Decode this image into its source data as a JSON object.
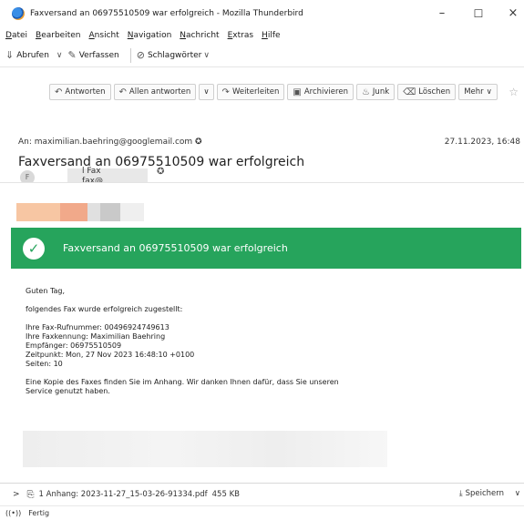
{
  "window": {
    "title": "Faxversand an 06975510509 war erfolgreich - Mozilla Thunderbird",
    "minimize": "–",
    "maximize": "☐",
    "close": "×"
  },
  "menu": [
    "Datei",
    "Bearbeiten",
    "Ansicht",
    "Navigation",
    "Nachricht",
    "Extras",
    "Hilfe"
  ],
  "mainbar": {
    "fetch": "Abrufen",
    "compose": "Verfassen",
    "tags": "Schlagwörter"
  },
  "actions": {
    "reply": "Antworten",
    "reply_all": "Allen antworten",
    "forward": "Weiterleiten",
    "archive": "Archivieren",
    "junk": "Junk",
    "delete": "Löschen",
    "more": "Mehr"
  },
  "header": {
    "avatar_letter": "F",
    "from_line1": "l Fax",
    "from_line2": "fax@",
    "to_label": "An",
    "to_address": "maximilian.baehring@googlemail.com",
    "date": "27.11.2023, 16:48",
    "subject": "Faxversand an 06975510509 war erfolgreich"
  },
  "banner": {
    "text": "Faxversand an 06975510509 war erfolgreich",
    "color": "#26a45c"
  },
  "mail": {
    "greeting": "Guten Tag,",
    "intro": "folgendes Fax wurde erfolgreich zugestellt:",
    "line_fax": "Ihre Fax-Rufnummer: 004969247496​13",
    "line_id": "Ihre Faxkennung: Maximilian Baehring",
    "line_recipient": "Empfänger: 06975510509",
    "line_time": "Zeitpunkt: Mon, 27 Nov 2023 16:48:10 +0100",
    "line_pages": "Seiten: 10",
    "outro1": "Eine Kopie des Faxes finden Sie im Anhang. Wir danken Ihnen dafür, dass Sie unseren",
    "outro2": "Service genutzt haben."
  },
  "attachment": {
    "label": "1 Anhang: 2023-11-27_15-03-26-91334.pdf",
    "size": "455 KB",
    "save": "Speichern"
  },
  "status": {
    "text": "Fertig"
  }
}
